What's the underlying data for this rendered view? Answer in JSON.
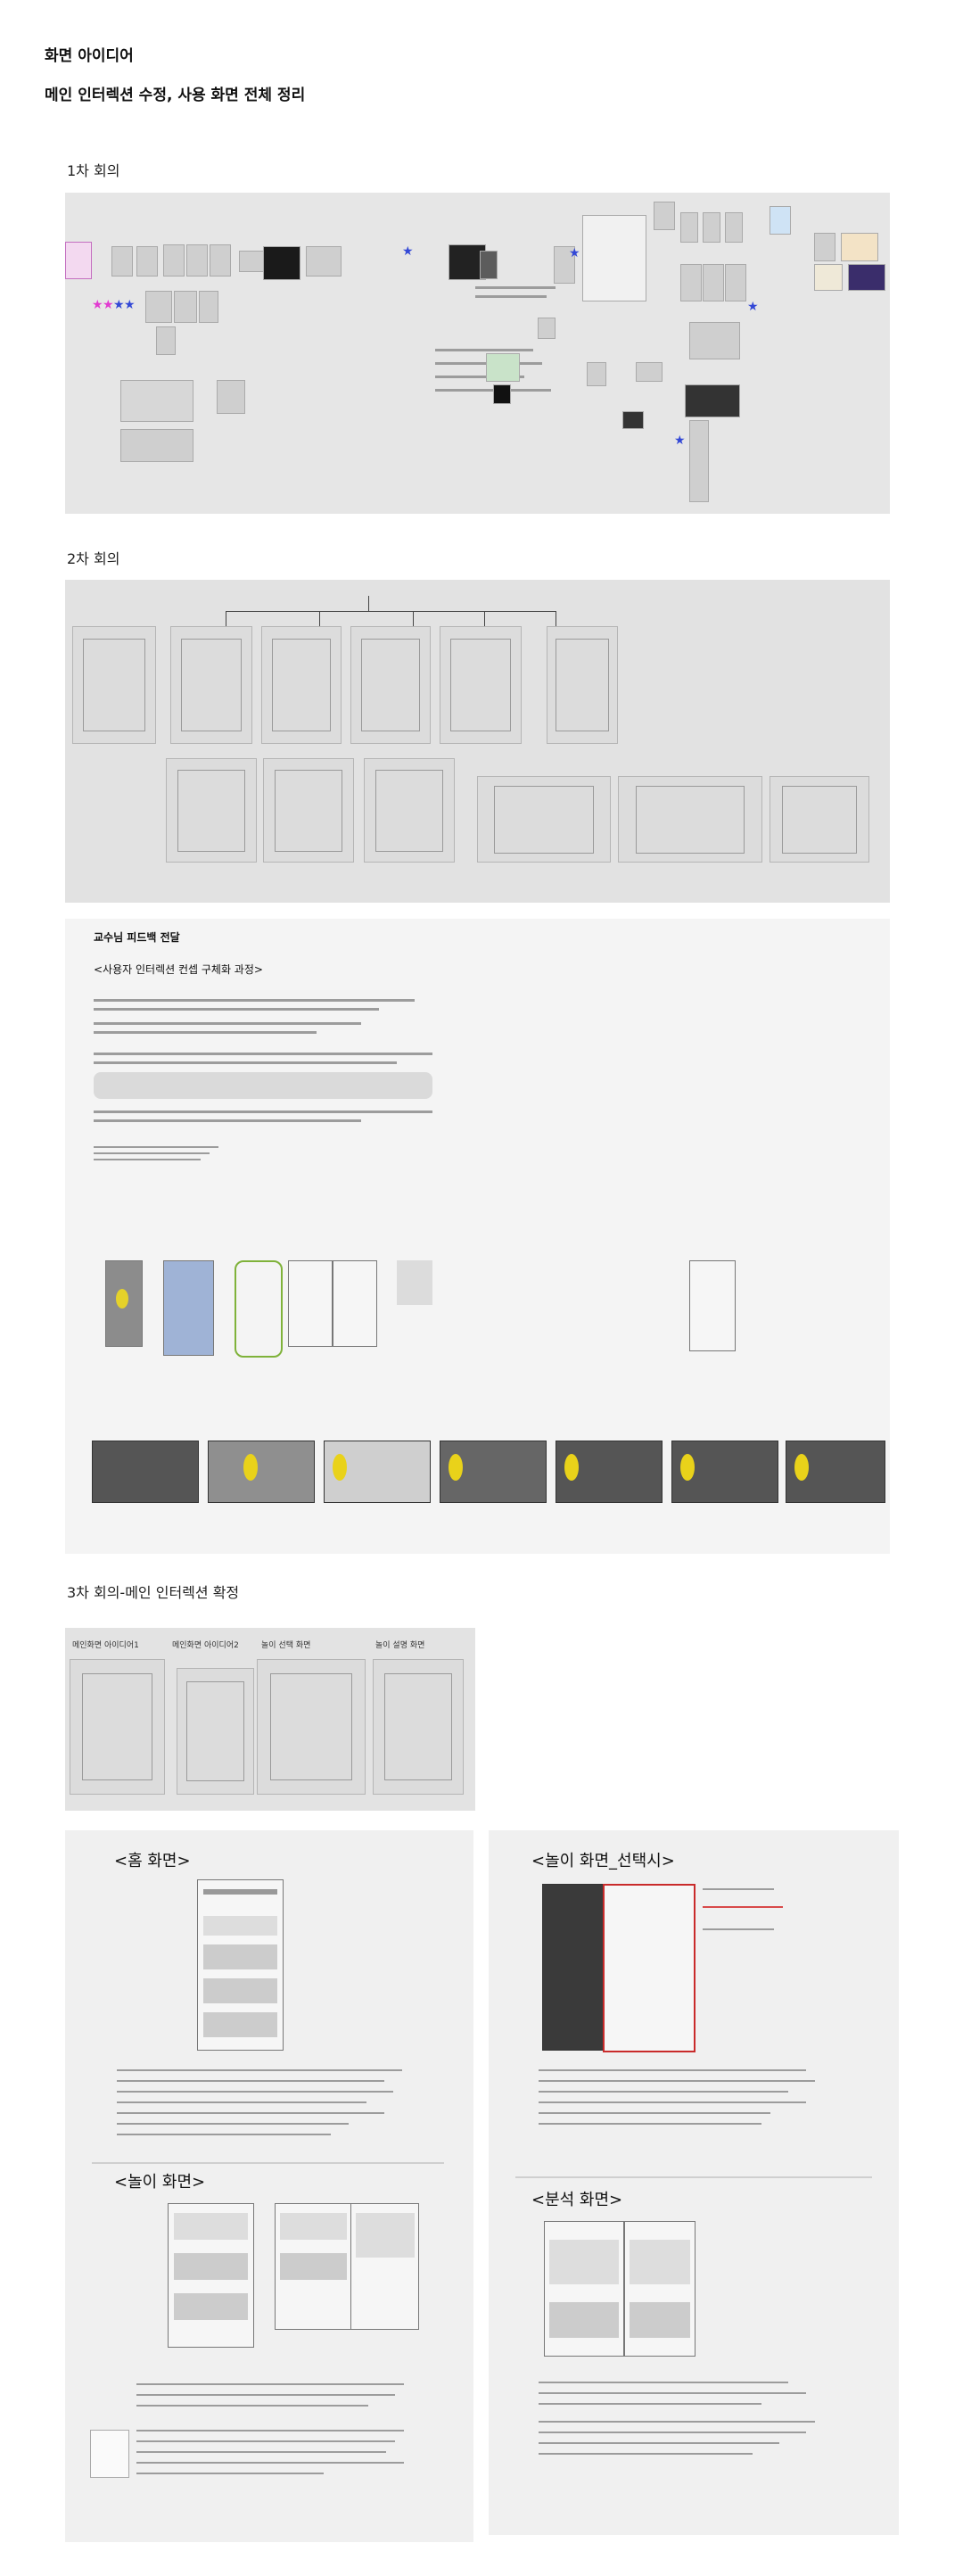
{
  "header": {
    "title": "화면 아이디어",
    "subtitle": "메인 인터렉션 수정, 사용 화면 전체 정리"
  },
  "meeting1": {
    "label": "1차 회의"
  },
  "meeting2": {
    "label": "2차 회의"
  },
  "feedback": {
    "title": "교수님 피드백 전달",
    "subtitle": "<사용자 인터렉션 컨셉 구체화 과정>"
  },
  "meeting3": {
    "label": "3차 회의-메인 인터렉션 확정",
    "captions": [
      "메인화면 아이디어1",
      "메인화면 아이디어2",
      "놀이 선택 화면",
      "놀이 설명 화면"
    ]
  },
  "screens": {
    "home": "<홈 화면>",
    "play": "<놀이 화면>",
    "play_select": "<놀이 화면_선택시>",
    "analysis": "<분석 화면>"
  }
}
